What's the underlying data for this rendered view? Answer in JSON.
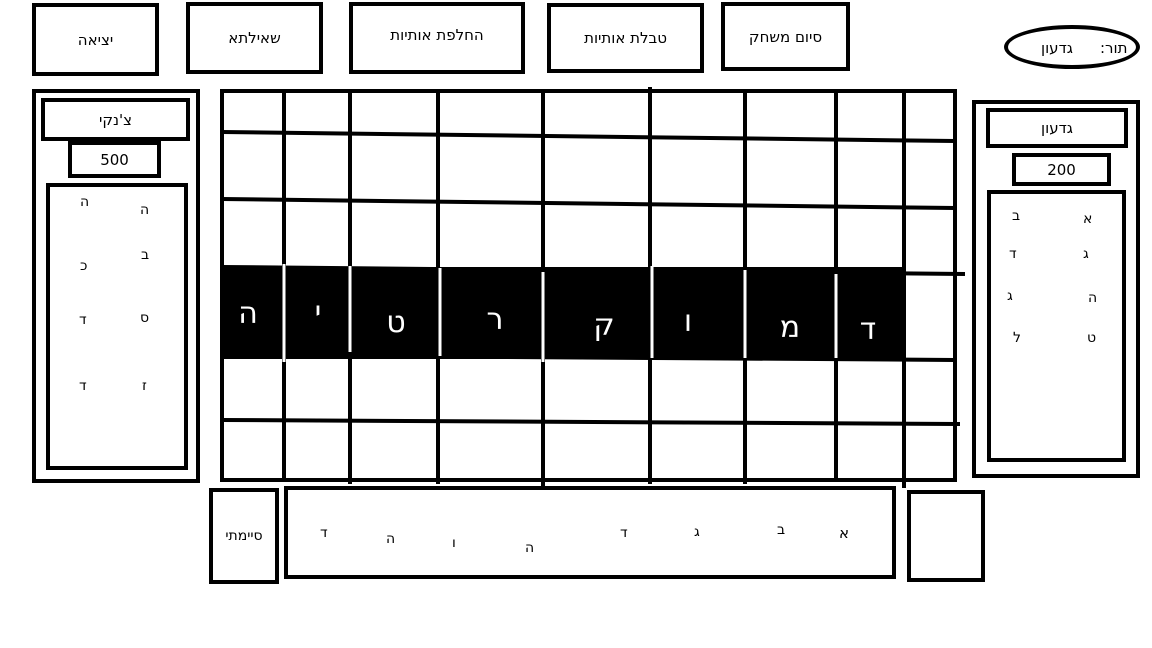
{
  "toolbar": {
    "exit": "יציאה",
    "question": "שאילתא",
    "swap_letters": "החלפת אותיות",
    "letter_table": "טבלת אותיות",
    "end_game": "סיום משחק"
  },
  "turn": {
    "label": "תור:",
    "player": "גדעון"
  },
  "left_player": {
    "name": "צ'נקי",
    "score": "500",
    "letters": [
      "ה",
      "ה",
      "ב",
      "כ",
      "ס",
      "ד",
      "ז",
      "ד"
    ]
  },
  "right_player": {
    "name": "גדעון",
    "score": "200",
    "letters": [
      "א",
      "ב",
      "ג",
      "ד",
      "ה",
      "ג",
      "ט",
      "ל"
    ]
  },
  "board": {
    "word_tiles": [
      "ה",
      "י",
      "ט",
      "ר",
      "ק",
      "ו",
      "מ",
      "ד"
    ]
  },
  "rack": {
    "finish_label": "סיימתי",
    "letters": [
      "א",
      "ב",
      "ג",
      "ד",
      "ה",
      "ו",
      "ה",
      "ד"
    ]
  },
  "colors": {
    "line": "#000000",
    "background": "#ffffff",
    "tile_text": "#ffffff"
  }
}
